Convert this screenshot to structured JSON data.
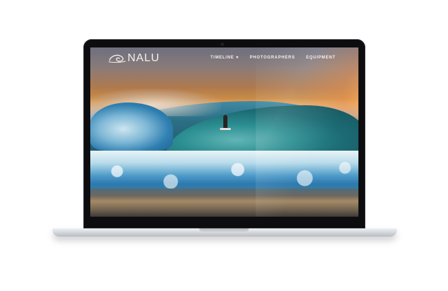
{
  "site": {
    "brand": "NALU",
    "nav": [
      {
        "label": "TIMELINE",
        "has_dropdown": true,
        "caret": "▾"
      },
      {
        "label": "PHOTOGRAPHERS",
        "has_dropdown": false
      },
      {
        "label": "EQUIPMENT",
        "has_dropdown": false
      }
    ]
  },
  "colors": {
    "nav_text": "#f4f1ee",
    "laptop_bezel": "#0d0d0f",
    "laptop_base": "#d6d9de"
  },
  "icons": {
    "logo": "wave-logo-icon",
    "dropdown": "chevron-down-icon"
  }
}
